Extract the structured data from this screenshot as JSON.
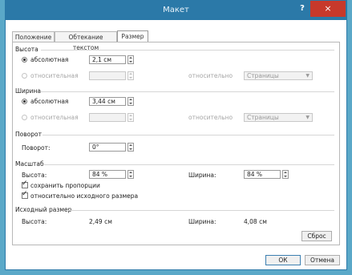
{
  "window": {
    "title": "Макет",
    "help": "?",
    "close": "×"
  },
  "tabs": [
    {
      "label": "Положение"
    },
    {
      "label": "Обтекание текстом"
    },
    {
      "label": "Размер"
    }
  ],
  "height": {
    "title": "Высота",
    "absolute_label": "абсолютная",
    "absolute_value": "2,1 см",
    "relative_label": "относительная",
    "relative_value": "",
    "relative_to_label": "относительно",
    "relative_to_value": "Страницы"
  },
  "width": {
    "title": "Ширина",
    "absolute_label": "абсолютная",
    "absolute_value": "3,44 см",
    "relative_label": "относительная",
    "relative_value": "",
    "relative_to_label": "относительно",
    "relative_to_value": "Страницы"
  },
  "rotation": {
    "title": "Поворот",
    "label": "Поворот:",
    "value": "0°"
  },
  "scale": {
    "title": "Масштаб",
    "height_label": "Высота:",
    "height_value": "84 %",
    "width_label": "Ширина:",
    "width_value": "84 %",
    "lock_aspect_label": "сохранить пропорции",
    "relative_original_label": "относительно исходного размера"
  },
  "original": {
    "title": "Исходный размер",
    "height_label": "Высота:",
    "height_value": "2,49 см",
    "width_label": "Ширина:",
    "width_value": "4,08 см",
    "reset_label": "Сброс"
  },
  "footer": {
    "ok_label": "ОК",
    "cancel_label": "Отмена"
  },
  "colors": {
    "titlebar": "#2b79a8",
    "close": "#c7392b",
    "background": "#5aa8c8"
  }
}
